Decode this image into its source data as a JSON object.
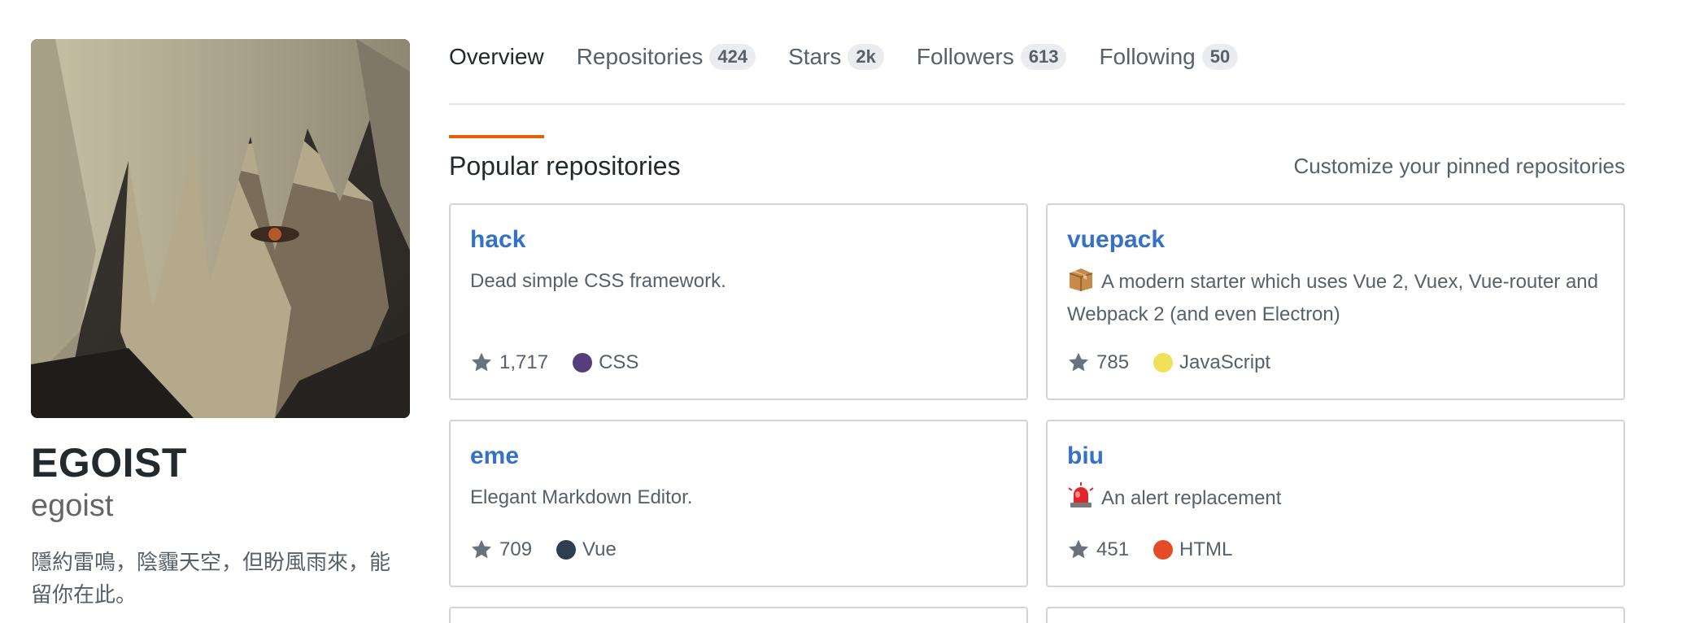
{
  "profile": {
    "avatar_alt": "avatar",
    "fullname": "EGOIST",
    "username": "egoist",
    "bio": "隱約雷鳴，陰霾天空，但盼風雨來，能留你在此。"
  },
  "tabs": [
    {
      "label": "Overview",
      "count": null,
      "selected": true
    },
    {
      "label": "Repositories",
      "count": "424",
      "selected": false
    },
    {
      "label": "Stars",
      "count": "2k",
      "selected": false
    },
    {
      "label": "Followers",
      "count": "613",
      "selected": false
    },
    {
      "label": "Following",
      "count": "50",
      "selected": false
    }
  ],
  "section": {
    "title": "Popular repositories",
    "customize_link": "Customize your pinned repositories"
  },
  "repos": [
    {
      "name": "hack",
      "description": "Dead simple CSS framework.",
      "emoji": "",
      "stars": "1,717",
      "language": "CSS",
      "language_color": "#563d7c"
    },
    {
      "name": "vuepack",
      "description": "A modern starter which uses Vue 2, Vuex, Vue-router and Webpack 2 (and even Electron)",
      "emoji": "package-emoji",
      "stars": "785",
      "language": "JavaScript",
      "language_color": "#f1e05a"
    },
    {
      "name": "eme",
      "description": "Elegant Markdown Editor.",
      "emoji": "",
      "stars": "709",
      "language": "Vue",
      "language_color": "#2c3e50"
    },
    {
      "name": "biu",
      "description": "An alert replacement",
      "emoji": "rotating-light-emoji",
      "stars": "451",
      "language": "HTML",
      "language_color": "#e34c26"
    }
  ],
  "colors": {
    "accent": "#e36209",
    "link": "#3572c6",
    "muted": "#586069"
  }
}
